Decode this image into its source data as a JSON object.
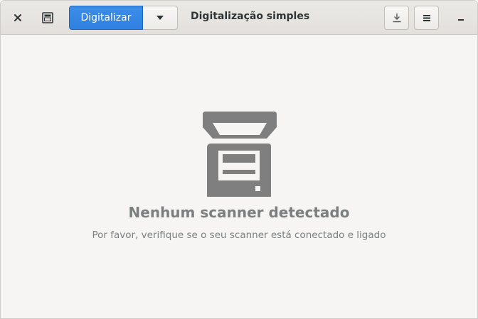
{
  "headerbar": {
    "close_icon": "close-icon",
    "photo_mode_icon": "photo-mode-icon",
    "scan_button_label": "Digitalizar",
    "scan_dropdown_icon": "chevron-down-icon",
    "title": "Digitalização simples",
    "save_icon": "download-icon",
    "menu_icon": "hamburger-menu-icon",
    "minimize_icon": "minimize-icon"
  },
  "empty_state": {
    "icon": "scanner-icon",
    "title": "Nenhum scanner detectado",
    "description": "Por favor, verifique se o seu scanner está conectado e ligado"
  },
  "colors": {
    "accent": "#3584e4",
    "headerbar_bg": "#e6e3df",
    "content_bg": "#f6f5f4",
    "muted_text": "#7b7f80",
    "icon_gray": "#7f7f7f"
  }
}
